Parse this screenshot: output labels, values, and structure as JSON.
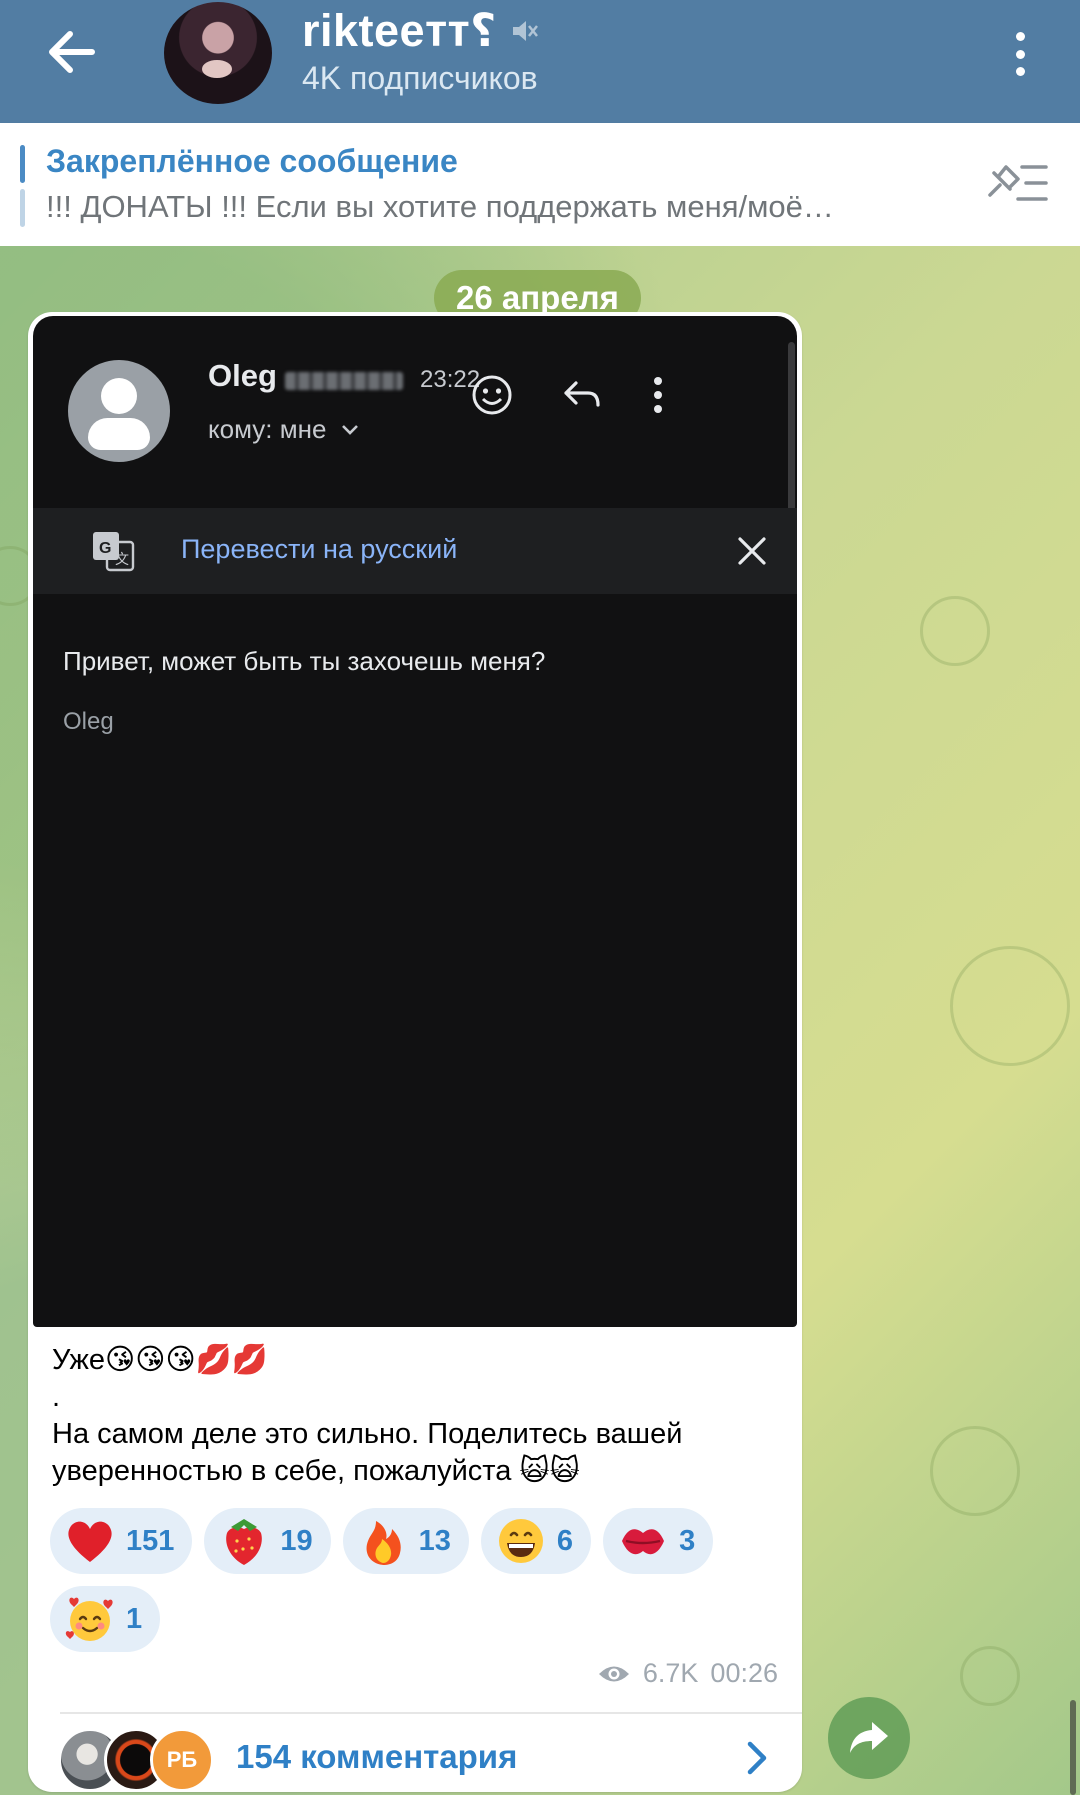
{
  "header": {
    "title": "rikteeтт⸮",
    "subtitle": "4K подписчиков",
    "muted": true
  },
  "pinned": {
    "title": "Закреплённое сообщение",
    "text": "!!! ДОНАТЫ !!! Если вы хотите поддержать меня/моё…"
  },
  "date_chip": "26 апреля",
  "screenshot": {
    "sender": "Oleg",
    "time": "23:22",
    "to": "кому: мне",
    "translate": "Перевести на русский",
    "body": "Привет, может быть ты захочешь меня?",
    "signature": "Oleg"
  },
  "caption": {
    "line1": "Уже😘😘😘💋💋",
    "line2": ".",
    "line3": "На самом деле это сильно. Поделитесь вашей",
    "line4": "уверенностью в себе,  пожалуйста 🙀🙀"
  },
  "reactions": [
    {
      "emoji": "❤️",
      "count": "151"
    },
    {
      "emoji": "🍓",
      "count": "19"
    },
    {
      "emoji": "🔥",
      "count": "13"
    },
    {
      "emoji": "😁",
      "count": "6"
    },
    {
      "emoji": "💋",
      "count": "3"
    },
    {
      "emoji": "🥰",
      "count": "1"
    }
  ],
  "meta": {
    "views": "6.7K",
    "time": "00:26"
  },
  "comments": {
    "label": "154 комментария",
    "avatar_initials": "РБ"
  },
  "colors": {
    "header_bg": "#527da3",
    "accent": "#2f80c6",
    "reaction_bg": "#e4eef8",
    "chat_green": "#b9cf8e"
  }
}
